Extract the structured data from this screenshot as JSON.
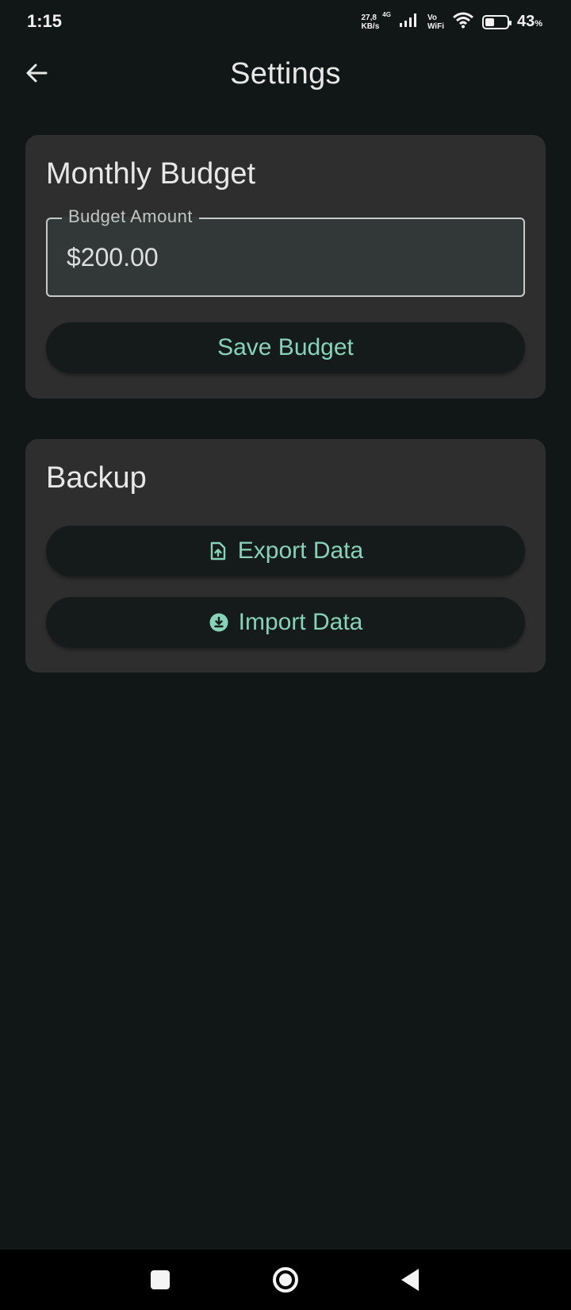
{
  "status_bar": {
    "time": "1:15",
    "net_speed_value": "27,8",
    "net_speed_unit": "KB/s",
    "network_gen": "4G",
    "vo_label": "Vo",
    "wifi_label": "WiFi",
    "battery_value": "43",
    "battery_unit": "%",
    "icons": [
      "signal-icon",
      "wifi-icon",
      "battery-icon"
    ]
  },
  "app_bar": {
    "title": "Settings",
    "back_icon": "arrow-back-icon"
  },
  "budget_card": {
    "title": "Monthly Budget",
    "field_label": "Budget Amount",
    "field_value": "$200.00",
    "save_label": "Save Budget"
  },
  "backup_card": {
    "title": "Backup",
    "export_label": "Export Data",
    "export_icon": "file-upload-icon",
    "import_label": "Import Data",
    "import_icon": "download-circle-icon"
  },
  "nav_bar": {
    "icons": [
      "recents-square-icon",
      "home-circle-icon",
      "back-triangle-icon"
    ]
  },
  "colors": {
    "background": "#111716",
    "card": "#2e2e2f",
    "accent": "#86d3b8",
    "button": "#151b1a"
  }
}
